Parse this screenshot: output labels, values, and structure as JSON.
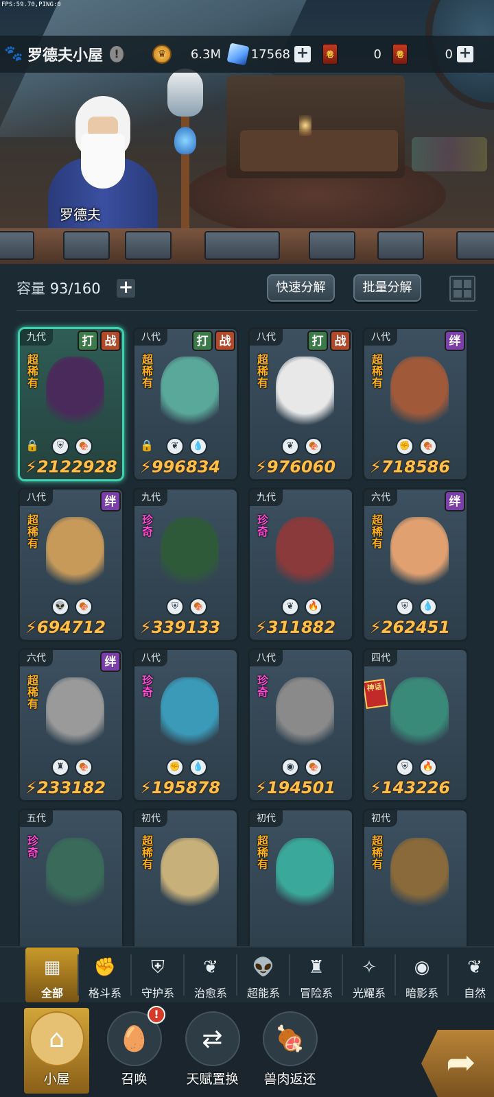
{
  "status": {
    "fps_text": "FPS:59.70,PING:0"
  },
  "header": {
    "title": "罗德夫小屋",
    "info_icon": "exclamation-icon",
    "resources": [
      {
        "name": "gold",
        "icon": "coin-icon",
        "value": "6.3M",
        "has_plus": false
      },
      {
        "name": "crystal",
        "icon": "crystal-icon",
        "value": "17568",
        "has_plus": true
      },
      {
        "name": "ticket-red",
        "icon": "ticket-icon",
        "value": "0",
        "has_plus": false
      },
      {
        "name": "ticket-dark",
        "icon": "ticket-icon",
        "value": "0",
        "has_plus": true
      }
    ]
  },
  "scene": {
    "npc_name": "罗德夫"
  },
  "inventory": {
    "capacity_label": "容量",
    "capacity_value": "93/160",
    "quick_decompose": "快速分解",
    "batch_decompose": "批量分解"
  },
  "cards": [
    {
      "gen": "九代",
      "rarity": "超稀有",
      "rarity_type": "sr",
      "tags": [
        "打",
        "战"
      ],
      "power": "2122928",
      "locked": true,
      "elements": [
        "shield-icon",
        "meat-icon"
      ],
      "selected": true,
      "color": "#4a2a5a"
    },
    {
      "gen": "八代",
      "rarity": "超稀有",
      "rarity_type": "sr",
      "tags": [
        "打",
        "战"
      ],
      "power": "996834",
      "locked": true,
      "elements": [
        "leaf-icon",
        "water-icon"
      ],
      "selected": false,
      "color": "#5aa89a"
    },
    {
      "gen": "八代",
      "rarity": "超稀有",
      "rarity_type": "sr",
      "tags": [
        "打",
        "战"
      ],
      "power": "976060",
      "locked": false,
      "elements": [
        "leaf-icon",
        "meat-icon"
      ],
      "selected": false,
      "color": "#e8e8e8"
    },
    {
      "gen": "八代",
      "rarity": "超稀有",
      "rarity_type": "sr",
      "tags": [
        "绊"
      ],
      "power": "718586",
      "locked": false,
      "elements": [
        "fist-icon",
        "meat-icon"
      ],
      "selected": false,
      "color": "#a05a3a"
    },
    {
      "gen": "八代",
      "rarity": "超稀有",
      "rarity_type": "sr",
      "tags": [
        "绊"
      ],
      "power": "694712",
      "locked": false,
      "elements": [
        "alien-icon",
        "meat-icon"
      ],
      "selected": false,
      "color": "#c89a5a"
    },
    {
      "gen": "九代",
      "rarity": "珍奇",
      "rarity_type": "rare",
      "tags": [],
      "power": "339133",
      "locked": false,
      "elements": [
        "shield-icon",
        "meat-icon"
      ],
      "selected": false,
      "color": "#2f5a3a"
    },
    {
      "gen": "九代",
      "rarity": "珍奇",
      "rarity_type": "rare",
      "tags": [],
      "power": "311882",
      "locked": false,
      "elements": [
        "leaf-icon",
        "fire-icon"
      ],
      "selected": false,
      "color": "#8a3a3a"
    },
    {
      "gen": "六代",
      "rarity": "超稀有",
      "rarity_type": "sr",
      "tags": [
        "绊"
      ],
      "power": "262451",
      "locked": false,
      "elements": [
        "shield-icon",
        "water-icon"
      ],
      "selected": false,
      "color": "#e0a070"
    },
    {
      "gen": "六代",
      "rarity": "超稀有",
      "rarity_type": "sr",
      "tags": [
        "绊"
      ],
      "power": "233182",
      "locked": false,
      "elements": [
        "tower-icon",
        "meat-icon"
      ],
      "selected": false,
      "color": "#9a9a9a"
    },
    {
      "gen": "八代",
      "rarity": "珍奇",
      "rarity_type": "rare",
      "tags": [],
      "power": "195878",
      "locked": false,
      "elements": [
        "fist-icon",
        "water-icon"
      ],
      "selected": false,
      "color": "#3a9ab8"
    },
    {
      "gen": "八代",
      "rarity": "珍奇",
      "rarity_type": "rare",
      "tags": [],
      "power": "194501",
      "locked": false,
      "elements": [
        "eye-icon",
        "meat-icon"
      ],
      "selected": false,
      "color": "#8a8a8a"
    },
    {
      "gen": "四代",
      "rarity": "",
      "rarity_type": "special",
      "special_badge": "神话",
      "tags": [],
      "power": "143226",
      "locked": false,
      "elements": [
        "shield-icon",
        "fire-icon"
      ],
      "selected": false,
      "color": "#3a8a7a"
    },
    {
      "gen": "五代",
      "rarity": "珍奇",
      "rarity_type": "rare",
      "tags": [],
      "power": "",
      "locked": false,
      "elements": [],
      "selected": false,
      "color": "#3a6a5a"
    },
    {
      "gen": "初代",
      "rarity": "超稀有",
      "rarity_type": "sr",
      "tags": [],
      "power": "",
      "locked": false,
      "elements": [],
      "selected": false,
      "color": "#c8b07a"
    },
    {
      "gen": "初代",
      "rarity": "超稀有",
      "rarity_type": "sr",
      "tags": [],
      "power": "",
      "locked": false,
      "elements": [],
      "selected": false,
      "color": "#3aa89a"
    },
    {
      "gen": "初代",
      "rarity": "超稀有",
      "rarity_type": "sr",
      "tags": [],
      "power": "",
      "locked": false,
      "elements": [],
      "selected": false,
      "color": "#8a6a3a"
    }
  ],
  "categories": [
    {
      "label": "全部",
      "icon": "blocks-icon",
      "active": true
    },
    {
      "label": "格斗系",
      "icon": "fist-icon",
      "active": false
    },
    {
      "label": "守护系",
      "icon": "shield-icon",
      "active": false
    },
    {
      "label": "治愈系",
      "icon": "leaf-icon",
      "active": false
    },
    {
      "label": "超能系",
      "icon": "alien-icon",
      "active": false
    },
    {
      "label": "冒险系",
      "icon": "tower-icon",
      "active": false
    },
    {
      "label": "光耀系",
      "icon": "sparkle-icon",
      "active": false
    },
    {
      "label": "暗影系",
      "icon": "eye-icon",
      "active": false
    },
    {
      "label": "自然",
      "icon": "leaf-icon",
      "active": false
    }
  ],
  "bottom_nav": [
    {
      "label": "小屋",
      "icon": "house-icon",
      "active": true,
      "badge": ""
    },
    {
      "label": "召唤",
      "icon": "egg-icon",
      "active": false,
      "badge": "!"
    },
    {
      "label": "天赋置换",
      "icon": "swap-icon",
      "active": false,
      "badge": ""
    },
    {
      "label": "兽肉返还",
      "icon": "meat-icon",
      "active": false,
      "badge": ""
    }
  ],
  "go_button": {
    "icon": "arrow-return-icon"
  }
}
